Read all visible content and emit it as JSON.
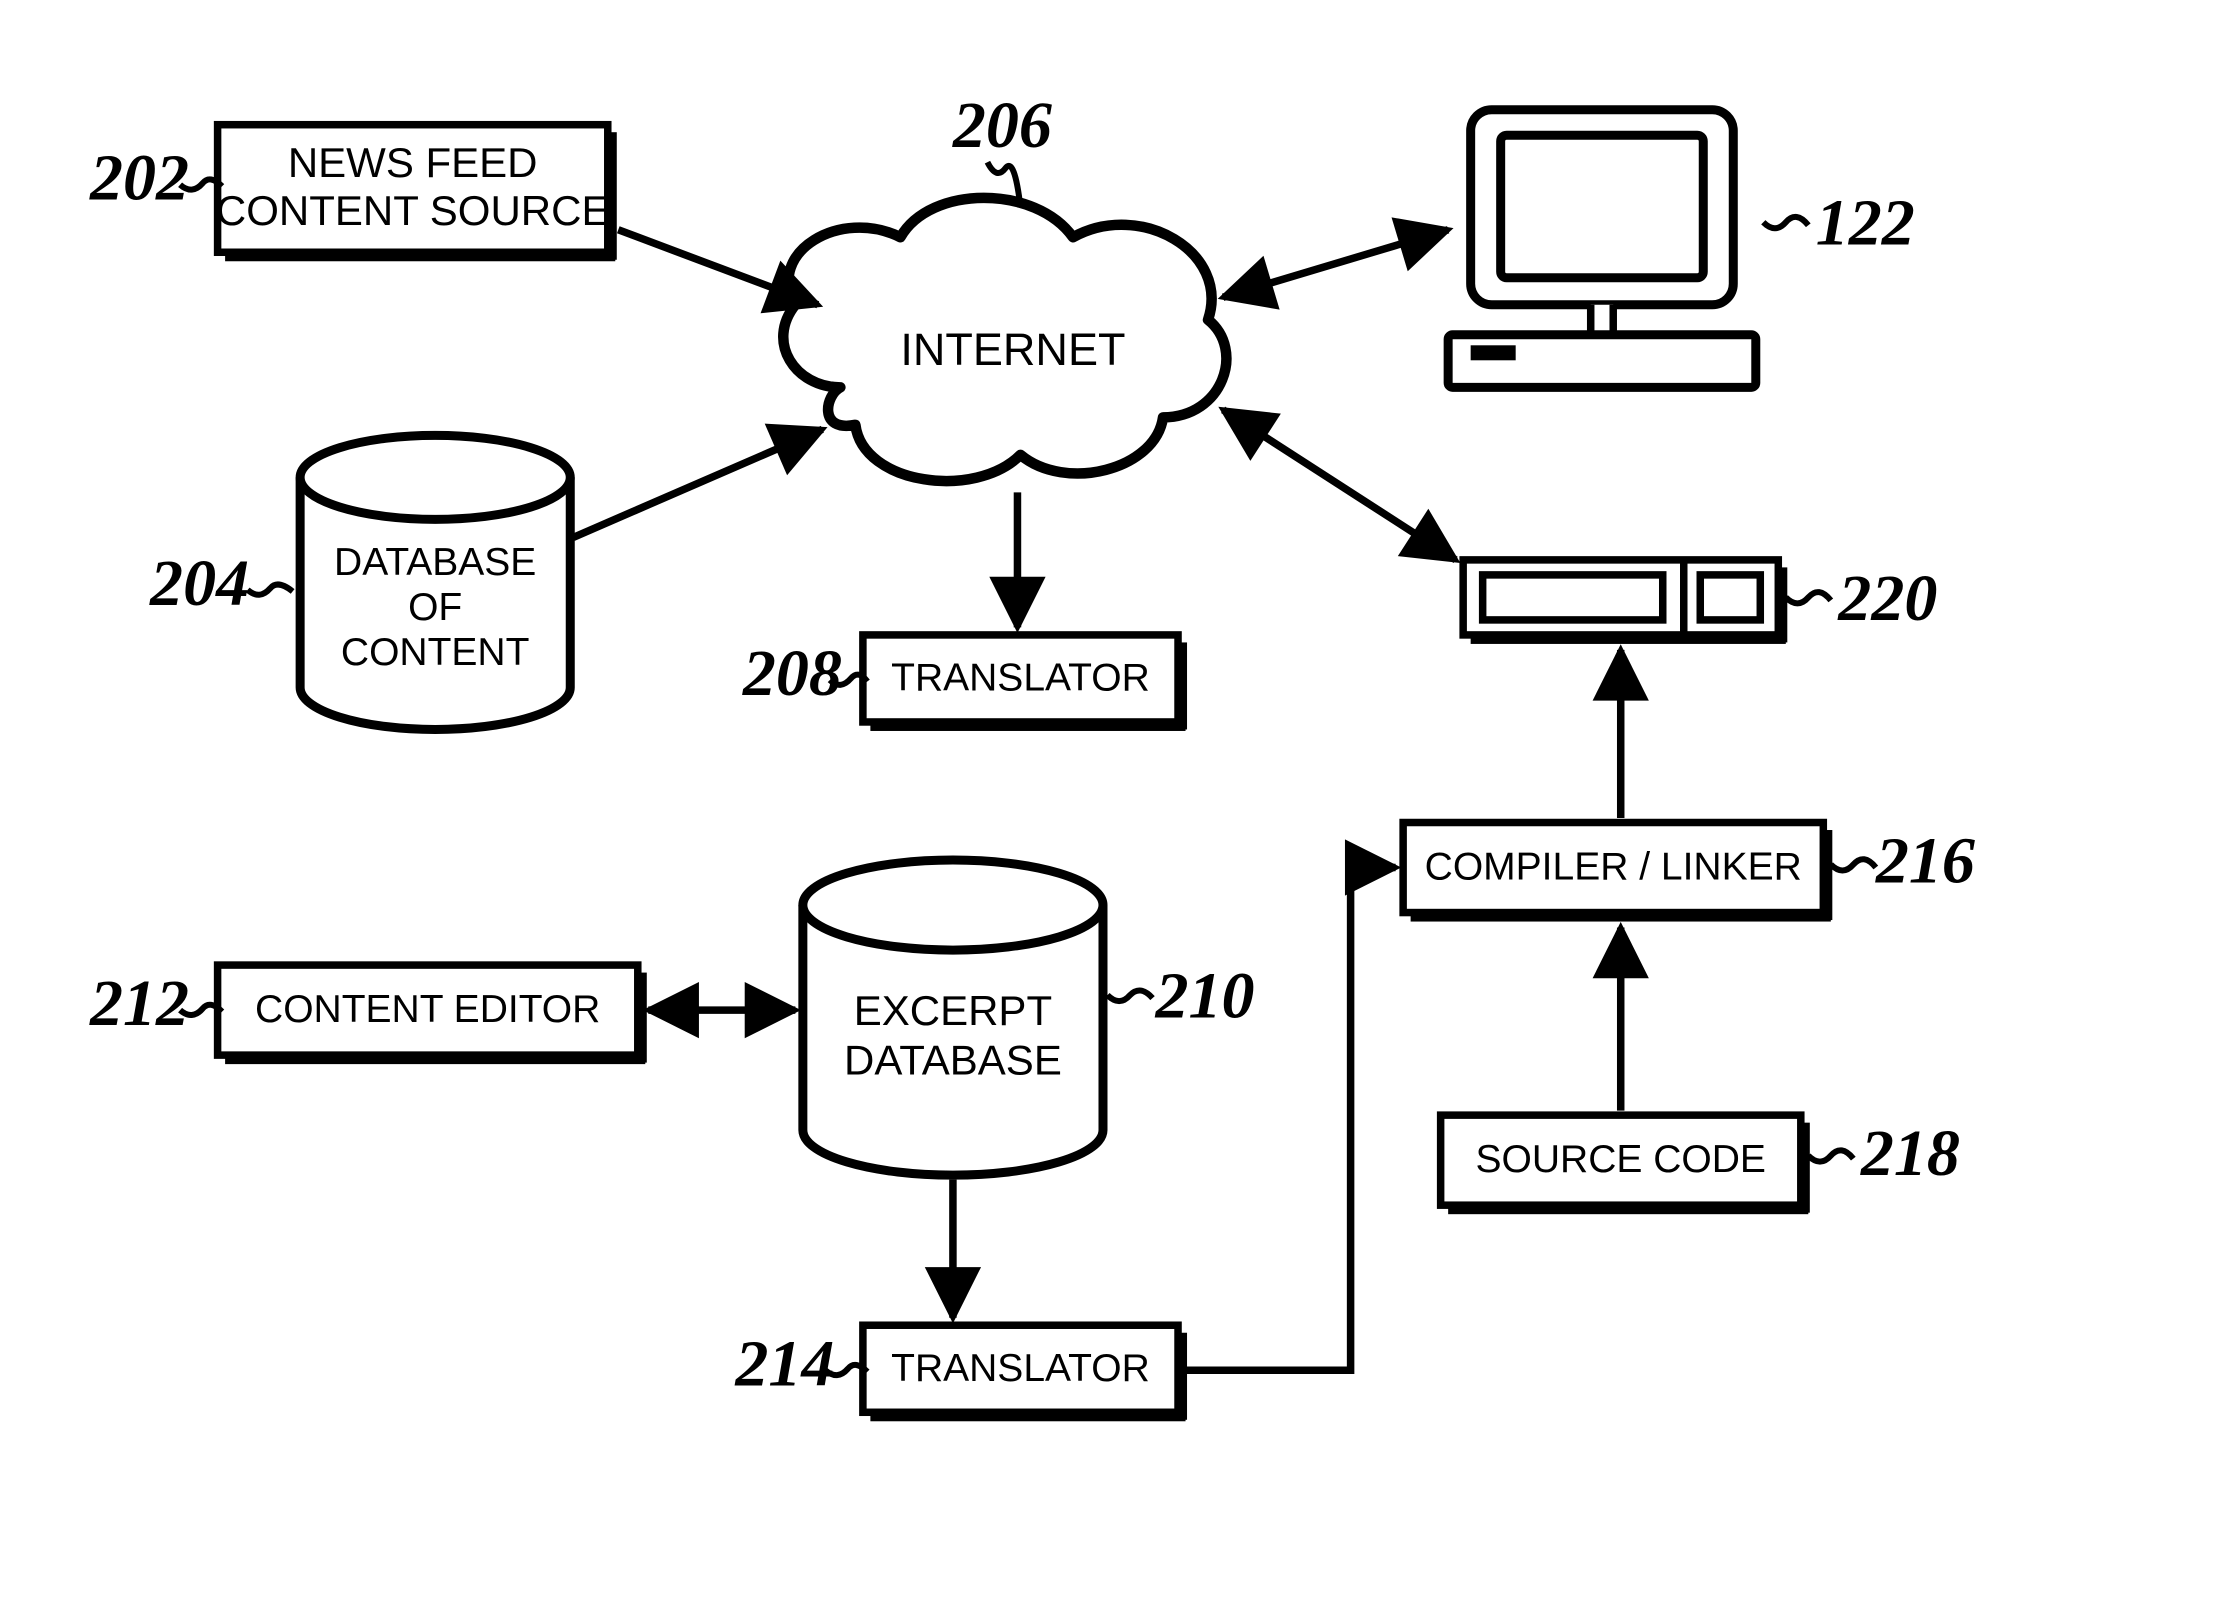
{
  "nodes": {
    "newsFeed": {
      "ref": "202",
      "label1": "NEWS FEED",
      "label2": "CONTENT SOURCE"
    },
    "database": {
      "ref": "204",
      "label1": "DATABASE",
      "label2": "OF",
      "label3": "CONTENT"
    },
    "internet": {
      "ref": "206",
      "label1": "INTERNET"
    },
    "translator1": {
      "ref": "208",
      "label1": "TRANSLATOR"
    },
    "excerpt": {
      "ref": "210",
      "label1": "EXCERPT",
      "label2": "DATABASE"
    },
    "editor": {
      "ref": "212",
      "label1": "CONTENT EDITOR"
    },
    "translator2": {
      "ref": "214",
      "label1": "TRANSLATOR"
    },
    "compiler": {
      "ref": "216",
      "label1": "COMPILER / LINKER"
    },
    "source": {
      "ref": "218",
      "label1": "SOURCE CODE"
    },
    "server": {
      "ref": "220"
    },
    "computer": {
      "ref": "122"
    }
  }
}
